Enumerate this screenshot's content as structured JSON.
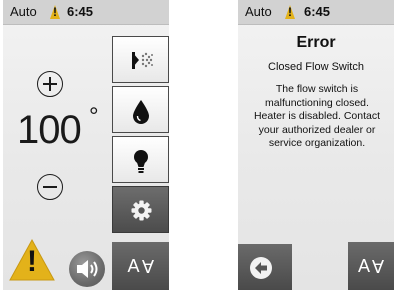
{
  "status_bar": {
    "mode": "Auto",
    "alert_symbol": "!",
    "time": "6:45"
  },
  "temperature": {
    "value": "100",
    "unit": "°",
    "increase_icon": "plus-circle-icon",
    "decrease_icon": "minus-circle-icon"
  },
  "tiles": [
    {
      "name": "jets-button",
      "icon": "jets-icon"
    },
    {
      "name": "water-care-button",
      "icon": "water-drop-icon"
    },
    {
      "name": "lights-button",
      "icon": "light-bulb-icon"
    },
    {
      "name": "settings-button",
      "icon": "gear-icon"
    }
  ],
  "bottom": {
    "warning_symbol": "!",
    "audio_icon": "speaker-icon",
    "font_button_label": "AA"
  },
  "error_screen": {
    "title": "Error",
    "subtitle": "Closed Flow Switch",
    "message_lines": [
      "The flow switch is",
      "malfunctioning closed.",
      "Heater is disabled. Contact",
      "your authorized dealer or",
      "service organization."
    ],
    "back_icon": "back-arrow-icon",
    "font_button_label": "AA"
  },
  "colors": {
    "warning_yellow": "#e3b21a",
    "dark_button": "#555555",
    "status_bar": "#d2d2d2"
  }
}
